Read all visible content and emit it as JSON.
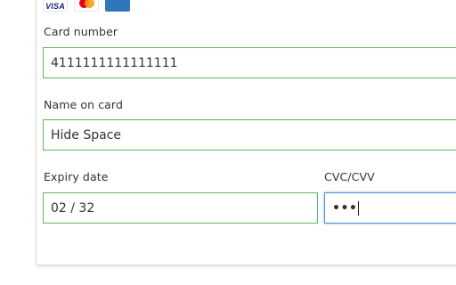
{
  "payment_logos": [
    "VISA",
    "mastercard",
    "AMEX"
  ],
  "card_number": {
    "label": "Card number",
    "value": "4111111111111111"
  },
  "name_on_card": {
    "label": "Name on card",
    "value": "Hide Space"
  },
  "expiry_date": {
    "label": "Expiry date",
    "value": "02 / 32"
  },
  "cvc": {
    "label": "CVC/CVV",
    "value_masked": "•••"
  },
  "colors": {
    "valid_border": "#5cb85c",
    "focus_border": "#4a90e2"
  }
}
